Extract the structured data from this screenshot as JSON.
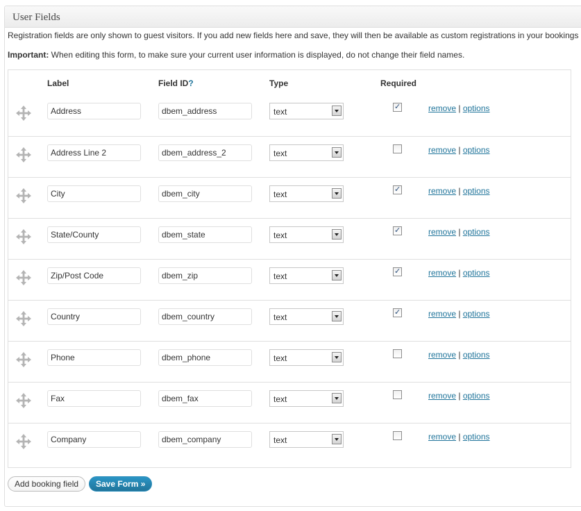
{
  "panel": {
    "title": "User Fields",
    "intro": "Registration fields are only shown to guest visitors. If you add new fields here and save, they will then be available as custom registrations in your bookings editor.",
    "important_label": "Important:",
    "important_text": " When editing this form, to make sure your current user information is displayed, do not change their field names."
  },
  "table": {
    "headers": {
      "label": "Label",
      "field_id": "Field ID",
      "field_id_help": "?",
      "type": "Type",
      "required": "Required"
    },
    "action_remove": "remove",
    "action_sep": " | ",
    "action_options": "options",
    "rows": [
      {
        "label": "Address",
        "field_id": "dbem_address",
        "type": "text",
        "required": true
      },
      {
        "label": "Address Line 2",
        "field_id": "dbem_address_2",
        "type": "text",
        "required": false
      },
      {
        "label": "City",
        "field_id": "dbem_city",
        "type": "text",
        "required": true
      },
      {
        "label": "State/County",
        "field_id": "dbem_state",
        "type": "text",
        "required": true
      },
      {
        "label": "Zip/Post Code",
        "field_id": "dbem_zip",
        "type": "text",
        "required": true
      },
      {
        "label": "Country",
        "field_id": "dbem_country",
        "type": "text",
        "required": true
      },
      {
        "label": "Phone",
        "field_id": "dbem_phone",
        "type": "text",
        "required": false
      },
      {
        "label": "Fax",
        "field_id": "dbem_fax",
        "type": "text",
        "required": false
      },
      {
        "label": "Company",
        "field_id": "dbem_company",
        "type": "text",
        "required": false
      }
    ]
  },
  "buttons": {
    "add": "Add booking field",
    "save": "Save Form »"
  },
  "icons": {
    "drag": "move-arrows-icon",
    "select": "chevron-down-icon",
    "checkbox": "checkmark-icon"
  },
  "colors": {
    "link": "#21759b",
    "primary_button": "#21759b"
  }
}
